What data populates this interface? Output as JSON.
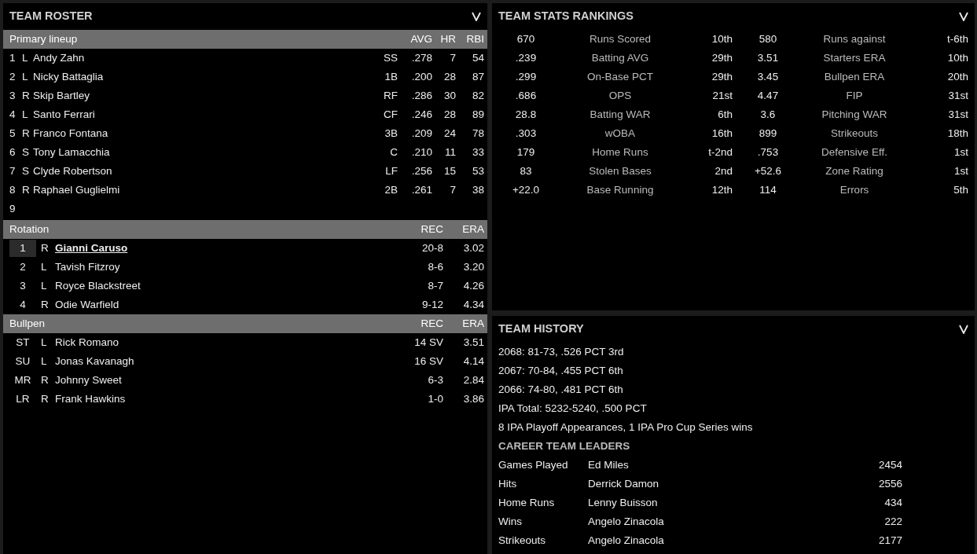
{
  "roster": {
    "title": "TEAM ROSTER",
    "lineup": {
      "title": "Primary lineup",
      "columns": [
        "AVG",
        "HR",
        "RBI"
      ],
      "rows": [
        {
          "order": "1",
          "bats": "L",
          "name": "Andy Zahn",
          "pos": "SS",
          "avg": ".278",
          "hr": "7",
          "rbi": "54"
        },
        {
          "order": "2",
          "bats": "L",
          "name": "Nicky Battaglia",
          "pos": "1B",
          "avg": ".200",
          "hr": "28",
          "rbi": "87"
        },
        {
          "order": "3",
          "bats": "R",
          "name": "Skip Bartley",
          "pos": "RF",
          "avg": ".286",
          "hr": "30",
          "rbi": "82"
        },
        {
          "order": "4",
          "bats": "L",
          "name": "Santo Ferrari",
          "pos": "CF",
          "avg": ".246",
          "hr": "28",
          "rbi": "89"
        },
        {
          "order": "5",
          "bats": "R",
          "name": "Franco Fontana",
          "pos": "3B",
          "avg": ".209",
          "hr": "24",
          "rbi": "78"
        },
        {
          "order": "6",
          "bats": "S",
          "name": "Tony Lamacchia",
          "pos": "C",
          "avg": ".210",
          "hr": "11",
          "rbi": "33"
        },
        {
          "order": "7",
          "bats": "S",
          "name": "Clyde Robertson",
          "pos": "LF",
          "avg": ".256",
          "hr": "15",
          "rbi": "53"
        },
        {
          "order": "8",
          "bats": "R",
          "name": "Raphael Guglielmi",
          "pos": "2B",
          "avg": ".261",
          "hr": "7",
          "rbi": "38"
        },
        {
          "order": "9"
        }
      ]
    },
    "rotation": {
      "title": "Rotation",
      "columns": [
        "REC",
        "ERA"
      ],
      "rows": [
        {
          "slot": "1",
          "throws": "R",
          "name": "Gianni Caruso",
          "rec": "20-8",
          "era": "3.02",
          "selected": true
        },
        {
          "slot": "2",
          "throws": "L",
          "name": "Tavish Fitzroy",
          "rec": "8-6",
          "era": "3.20",
          "selected": false
        },
        {
          "slot": "3",
          "throws": "L",
          "name": "Royce Blackstreet",
          "rec": "8-7",
          "era": "4.26",
          "selected": false
        },
        {
          "slot": "4",
          "throws": "R",
          "name": "Odie Warfield",
          "rec": "9-12",
          "era": "4.34",
          "selected": false
        }
      ]
    },
    "bullpen": {
      "title": "Bullpen",
      "columns": [
        "REC",
        "ERA"
      ],
      "rows": [
        {
          "slot": "ST",
          "throws": "L",
          "name": "Rick Romano",
          "rec": "14 SV",
          "era": "3.51",
          "selected": false
        },
        {
          "slot": "SU",
          "throws": "L",
          "name": "Jonas Kavanagh",
          "rec": "16 SV",
          "era": "4.14",
          "selected": false
        },
        {
          "slot": "MR",
          "throws": "R",
          "name": "Johnny Sweet",
          "rec": "6-3",
          "era": "2.84",
          "selected": false
        },
        {
          "slot": "LR",
          "throws": "R",
          "name": "Frank Hawkins",
          "rec": "1-0",
          "era": "3.86",
          "selected": false
        }
      ]
    }
  },
  "rankings": {
    "title": "TEAM STATS RANKINGS",
    "rows": [
      {
        "value": "670",
        "label": "Runs Scored",
        "rank": "10th",
        "value_2": "580",
        "label_2": "Runs against",
        "rank_2": "t-6th"
      },
      {
        "value": ".239",
        "label": "Batting AVG",
        "rank": "29th",
        "value_2": "3.51",
        "label_2": "Starters ERA",
        "rank_2": "10th"
      },
      {
        "value": ".299",
        "label": "On-Base PCT",
        "rank": "29th",
        "value_2": "3.45",
        "label_2": "Bullpen ERA",
        "rank_2": "20th"
      },
      {
        "value": ".686",
        "label": "OPS",
        "rank": "21st",
        "value_2": "4.47",
        "label_2": "FIP",
        "rank_2": "31st"
      },
      {
        "value": "28.8",
        "label": "Batting WAR",
        "rank": "6th",
        "value_2": "3.6",
        "label_2": "Pitching WAR",
        "rank_2": "31st"
      },
      {
        "value": ".303",
        "label": "wOBA",
        "rank": "16th",
        "value_2": "899",
        "label_2": "Strikeouts",
        "rank_2": "18th"
      },
      {
        "value": "179",
        "label": "Home Runs",
        "rank": "t-2nd",
        "value_2": ".753",
        "label_2": "Defensive Eff.",
        "rank_2": "1st"
      },
      {
        "value": "83",
        "label": "Stolen Bases",
        "rank": "2nd",
        "value_2": "+52.6",
        "label_2": "Zone Rating",
        "rank_2": "1st"
      },
      {
        "value": "+22.0",
        "label": "Base Running",
        "rank": "12th",
        "value_2": "114",
        "label_2": "Errors",
        "rank_2": "5th"
      }
    ]
  },
  "history": {
    "title": "TEAM HISTORY",
    "lines": [
      "2068: 81-73, .526 PCT 3rd",
      "2067: 70-84, .455 PCT 6th",
      "2066: 74-80, .481 PCT 6th",
      "IPA Total: 5232-5240, .500 PCT",
      "8 IPA Playoff Appearances, 1 IPA Pro Cup Series wins"
    ],
    "leaders_title": "CAREER TEAM LEADERS",
    "leaders": [
      {
        "category": "Games Played",
        "player": "Ed Miles",
        "value": "2454"
      },
      {
        "category": "Hits",
        "player": "Derrick Damon",
        "value": "2556"
      },
      {
        "category": "Home Runs",
        "player": "Lenny Buisson",
        "value": "434"
      },
      {
        "category": "Wins",
        "player": "Angelo Zinacola",
        "value": "222"
      },
      {
        "category": "Strikeouts",
        "player": "Angelo Zinacola",
        "value": "2177"
      }
    ]
  }
}
